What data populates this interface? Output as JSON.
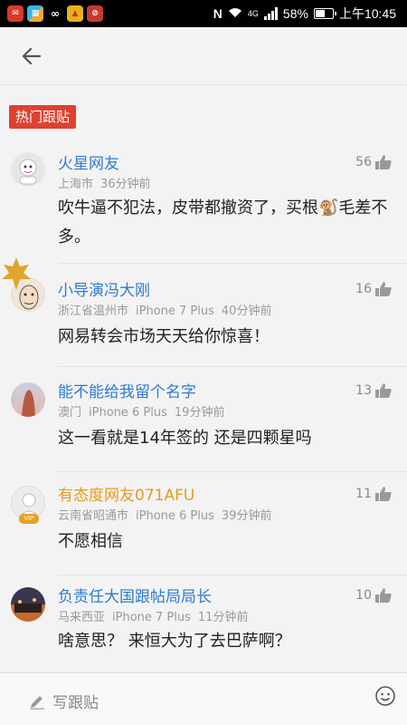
{
  "status_bar": {
    "battery": "58%",
    "time": "上午10:45",
    "network": "4G",
    "battery_level": 0.58
  },
  "header": {
    "back_icon": "arrow-left-icon"
  },
  "section_label": "热门跟贴",
  "comments": [
    {
      "name": "火星网友",
      "location": "上海市",
      "device": "",
      "time": "36分钟前",
      "likes": "56",
      "text": "吹牛逼不犯法，皮带都撤资了，买根🐒毛差不多。"
    },
    {
      "name": "小导演冯大刚",
      "location": "浙江省温州市",
      "device": "iPhone 7 Plus",
      "time": "40分钟前",
      "likes": "16",
      "text": "网易转会市场天天给你惊喜！"
    },
    {
      "name": "能不能给我留个名字",
      "location": "澳门",
      "device": "iPhone 6 Plus",
      "time": "19分钟前",
      "likes": "13",
      "text": "这一看就是14年签的 还是四颗星吗"
    },
    {
      "name": "有态度网友071AFU",
      "location": "云南省昭通市",
      "device": "iPhone 6 Plus",
      "time": "39分钟前",
      "likes": "11",
      "text": "不愿相信"
    },
    {
      "name": "负责任大国跟帖局局长",
      "location": "马来西亚",
      "device": "iPhone 7 Plus",
      "time": "11分钟前",
      "likes": "10",
      "text": "啥意思？ 来恒大为了去巴萨啊？"
    }
  ],
  "bottom_bar": {
    "write_placeholder": "写跟贴"
  },
  "colors": {
    "accent_red": "#e0402f",
    "username_blue": "#2d7bd6",
    "username_vip_orange": "#e89a1e"
  }
}
